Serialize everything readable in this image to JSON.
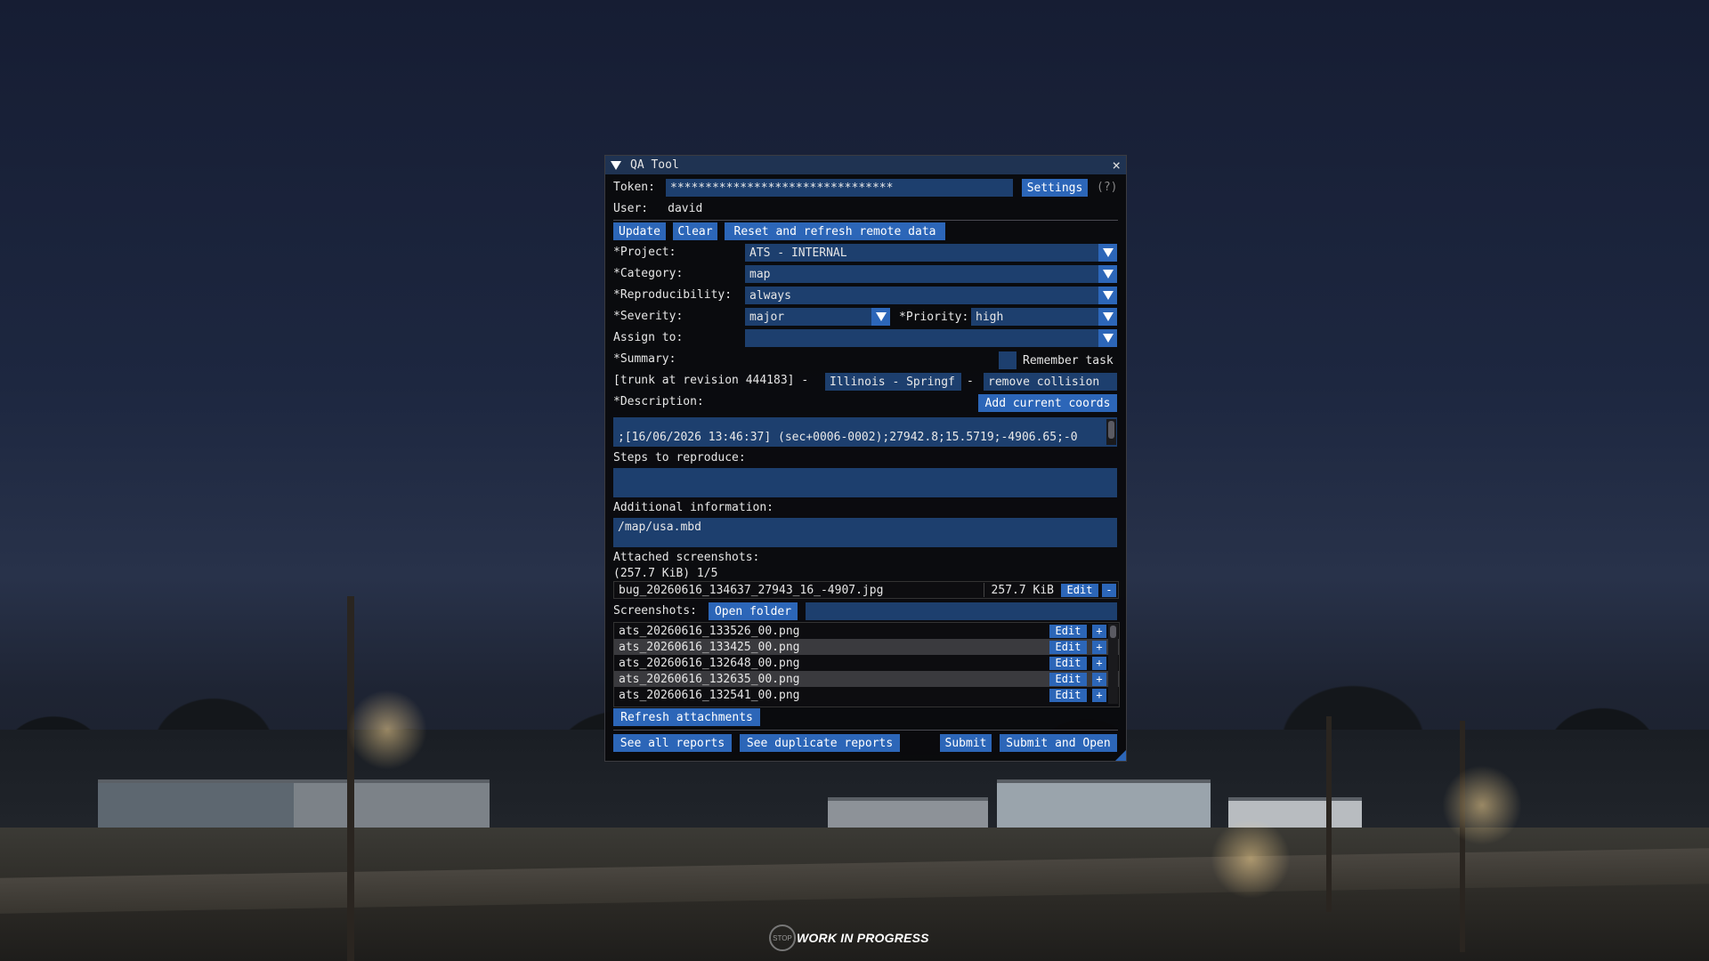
{
  "window": {
    "title": "QA Tool",
    "close_glyph": "×"
  },
  "token": {
    "label": "Token:",
    "value": "********************************",
    "settings_label": "Settings",
    "help_label": "(?)"
  },
  "user": {
    "label": "User:",
    "value": "david"
  },
  "actions": {
    "update": "Update",
    "clear": "Clear",
    "reset": "Reset and refresh remote data"
  },
  "form": {
    "project": {
      "label": "*Project:",
      "value": "ATS - INTERNAL"
    },
    "category": {
      "label": "*Category:",
      "value": "map"
    },
    "reproducibility": {
      "label": "*Reproducibility:",
      "value": "always"
    },
    "severity": {
      "label": "*Severity:",
      "value": "major"
    },
    "priority": {
      "label": "*Priority:",
      "value": "high"
    },
    "assign": {
      "label": "Assign to:",
      "value": ""
    },
    "summary": {
      "label": "*Summary:",
      "remember_label": "Remember task",
      "prefix": "[trunk at revision 444183] -",
      "location": "Illinois - Springf",
      "dash": "-",
      "text": "remove collision"
    },
    "description": {
      "label": "*Description:",
      "add_coords": "Add current coords",
      "value": ";[16/06/2026 13:46:37] (sec+0006-0002);27942.8;15.5719;-4906.65;-0"
    },
    "steps": {
      "label": "Steps to reproduce:",
      "value": ""
    },
    "additional": {
      "label": "Additional information:",
      "value": "/map/usa.mbd"
    }
  },
  "attached": {
    "label": "Attached screenshots:",
    "summary": "(257.7 KiB) 1/5",
    "file": {
      "name": "bug_20260616_134637_27943_16_-4907.jpg",
      "size": "257.7 KiB",
      "edit": "Edit",
      "remove": "-"
    }
  },
  "screenshots": {
    "label": "Screenshots:",
    "open_folder": "Open folder",
    "filter": "",
    "edit": "Edit",
    "add": "+",
    "items": [
      "ats_20260616_133526_00.png",
      "ats_20260616_133425_00.png",
      "ats_20260616_132648_00.png",
      "ats_20260616_132635_00.png",
      "ats_20260616_132541_00.png"
    ],
    "refresh": "Refresh attachments"
  },
  "footer": {
    "see_all": "See all reports",
    "see_dup": "See duplicate reports",
    "submit": "Submit",
    "submit_open": "Submit and Open"
  },
  "overlay": {
    "wip": "WORK IN PROGRESS",
    "stop": "STOP"
  },
  "colors": {
    "button": "#2c66b8",
    "field": "#1d3f6e",
    "title_bar": "#1f3352",
    "window_bg": "#0a0a0c"
  }
}
